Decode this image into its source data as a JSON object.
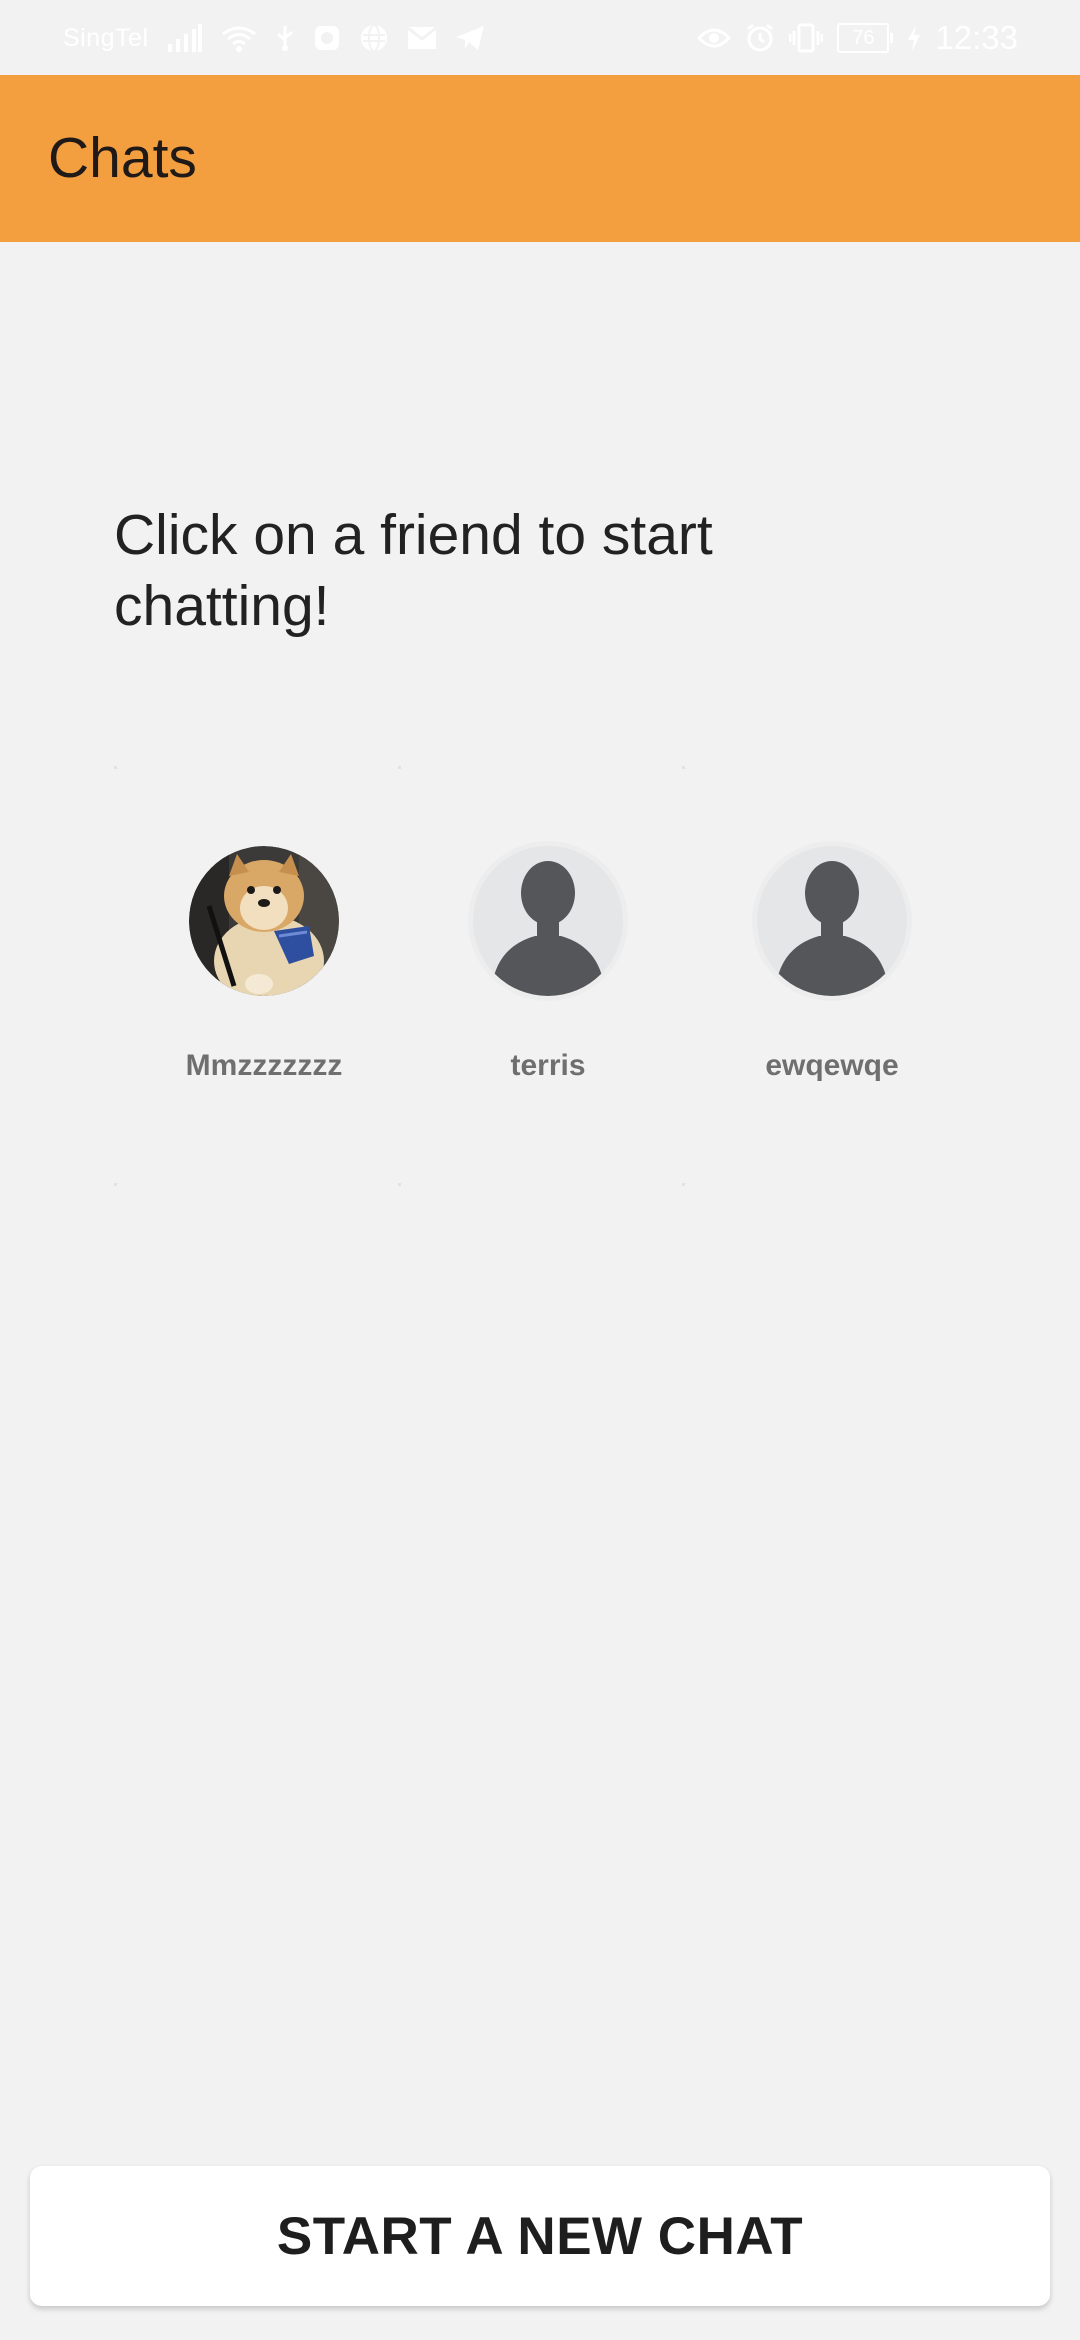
{
  "status_bar": {
    "carrier": "SingTel",
    "battery_level": "76",
    "time": "12:33",
    "icons_left": [
      "signal-icon",
      "wifi-icon",
      "usb-icon",
      "app-notification-icon",
      "globe-icon",
      "mail-icon",
      "telegram-icon"
    ],
    "icons_right": [
      "eye-icon",
      "alarm-icon",
      "vibrate-icon",
      "battery-icon",
      "charging-icon"
    ]
  },
  "app_bar": {
    "title": "Chats",
    "color": "#f49f3f"
  },
  "main": {
    "prompt": "Click on a friend to start chatting!",
    "friends": [
      {
        "name": "Mmzzzzzzz",
        "avatar": "dog-photo"
      },
      {
        "name": "terris",
        "avatar": "default-person-icon"
      },
      {
        "name": "ewqewqe",
        "avatar": "default-person-icon"
      }
    ]
  },
  "actions": {
    "start_chat_label": "START A NEW CHAT"
  }
}
